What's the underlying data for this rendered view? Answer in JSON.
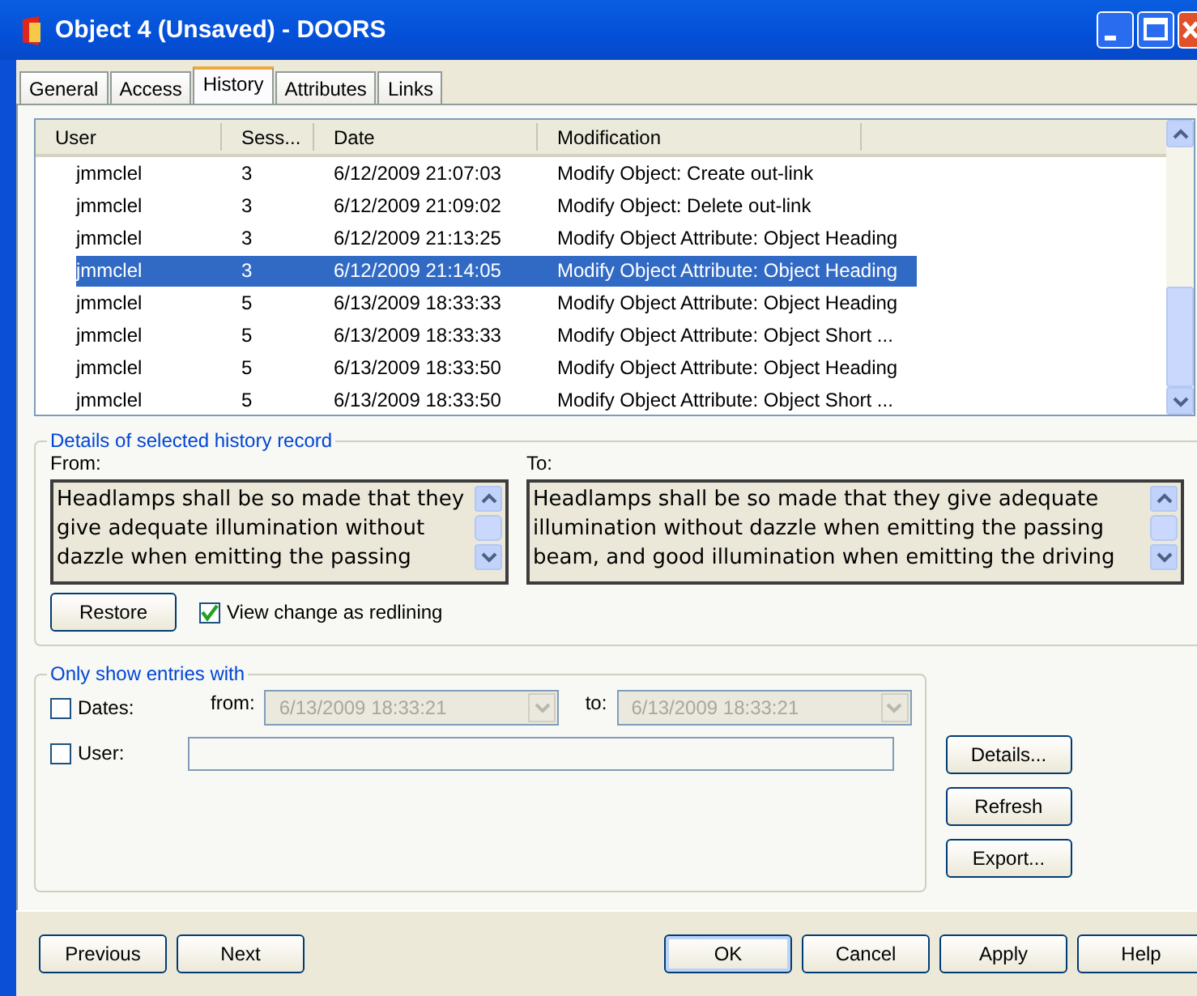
{
  "window": {
    "title": "Object 4 (Unsaved) - DOORS"
  },
  "tabs": [
    {
      "label": "General",
      "selected": false
    },
    {
      "label": "Access",
      "selected": false
    },
    {
      "label": "History",
      "selected": true
    },
    {
      "label": "Attributes",
      "selected": false
    },
    {
      "label": "Links",
      "selected": false
    }
  ],
  "history_table": {
    "columns": [
      "User",
      "Sess...",
      "Date",
      "Modification"
    ],
    "rows": [
      {
        "user": "jmmclel",
        "session": "3",
        "date": "6/12/2009 21:07:03",
        "modification": "Modify Object: Create out-link",
        "selected": false
      },
      {
        "user": "jmmclel",
        "session": "3",
        "date": "6/12/2009 21:09:02",
        "modification": "Modify Object: Delete out-link",
        "selected": false
      },
      {
        "user": "jmmclel",
        "session": "3",
        "date": "6/12/2009 21:13:25",
        "modification": "Modify Object Attribute: Object Heading",
        "selected": false
      },
      {
        "user": "jmmclel",
        "session": "3",
        "date": "6/12/2009 21:14:05",
        "modification": "Modify Object Attribute: Object Heading",
        "selected": true
      },
      {
        "user": "jmmclel",
        "session": "5",
        "date": "6/13/2009 18:33:33",
        "modification": "Modify Object Attribute: Object Heading",
        "selected": false
      },
      {
        "user": "jmmclel",
        "session": "5",
        "date": "6/13/2009 18:33:33",
        "modification": "Modify Object Attribute: Object Short ...",
        "selected": false
      },
      {
        "user": "jmmclel",
        "session": "5",
        "date": "6/13/2009 18:33:50",
        "modification": "Modify Object Attribute: Object Heading",
        "selected": false
      },
      {
        "user": "jmmclel",
        "session": "5",
        "date": "6/13/2009 18:33:50",
        "modification": "Modify Object Attribute: Object Short ...",
        "selected": false
      }
    ]
  },
  "details": {
    "title": "Details of selected history record",
    "from_label": "From:",
    "from_text": "Headlamps shall be so made that they give adequate illumination without dazzle when emitting the passing",
    "to_label": "To:",
    "to_text": "Headlamps shall be so made that they give adequate illumination without dazzle when emitting the passing beam, and good illumination when emitting the driving",
    "restore_button": "Restore",
    "redlining": {
      "label": "View change as redlining",
      "checked": true
    }
  },
  "filter": {
    "title": "Only show entries with",
    "dates": {
      "label": "Dates:",
      "checked": false,
      "from_label": "from:",
      "from_value": "6/13/2009 18:33:21",
      "to_label": "to:",
      "to_value": "6/13/2009 18:33:21",
      "disabled": true
    },
    "user": {
      "label": "User:",
      "checked": false
    }
  },
  "side_buttons": [
    "Details...",
    "Refresh",
    "Export..."
  ],
  "footer_left": [
    "Previous",
    "Next"
  ],
  "footer_right": [
    "OK",
    "Cancel",
    "Apply",
    "Help"
  ]
}
